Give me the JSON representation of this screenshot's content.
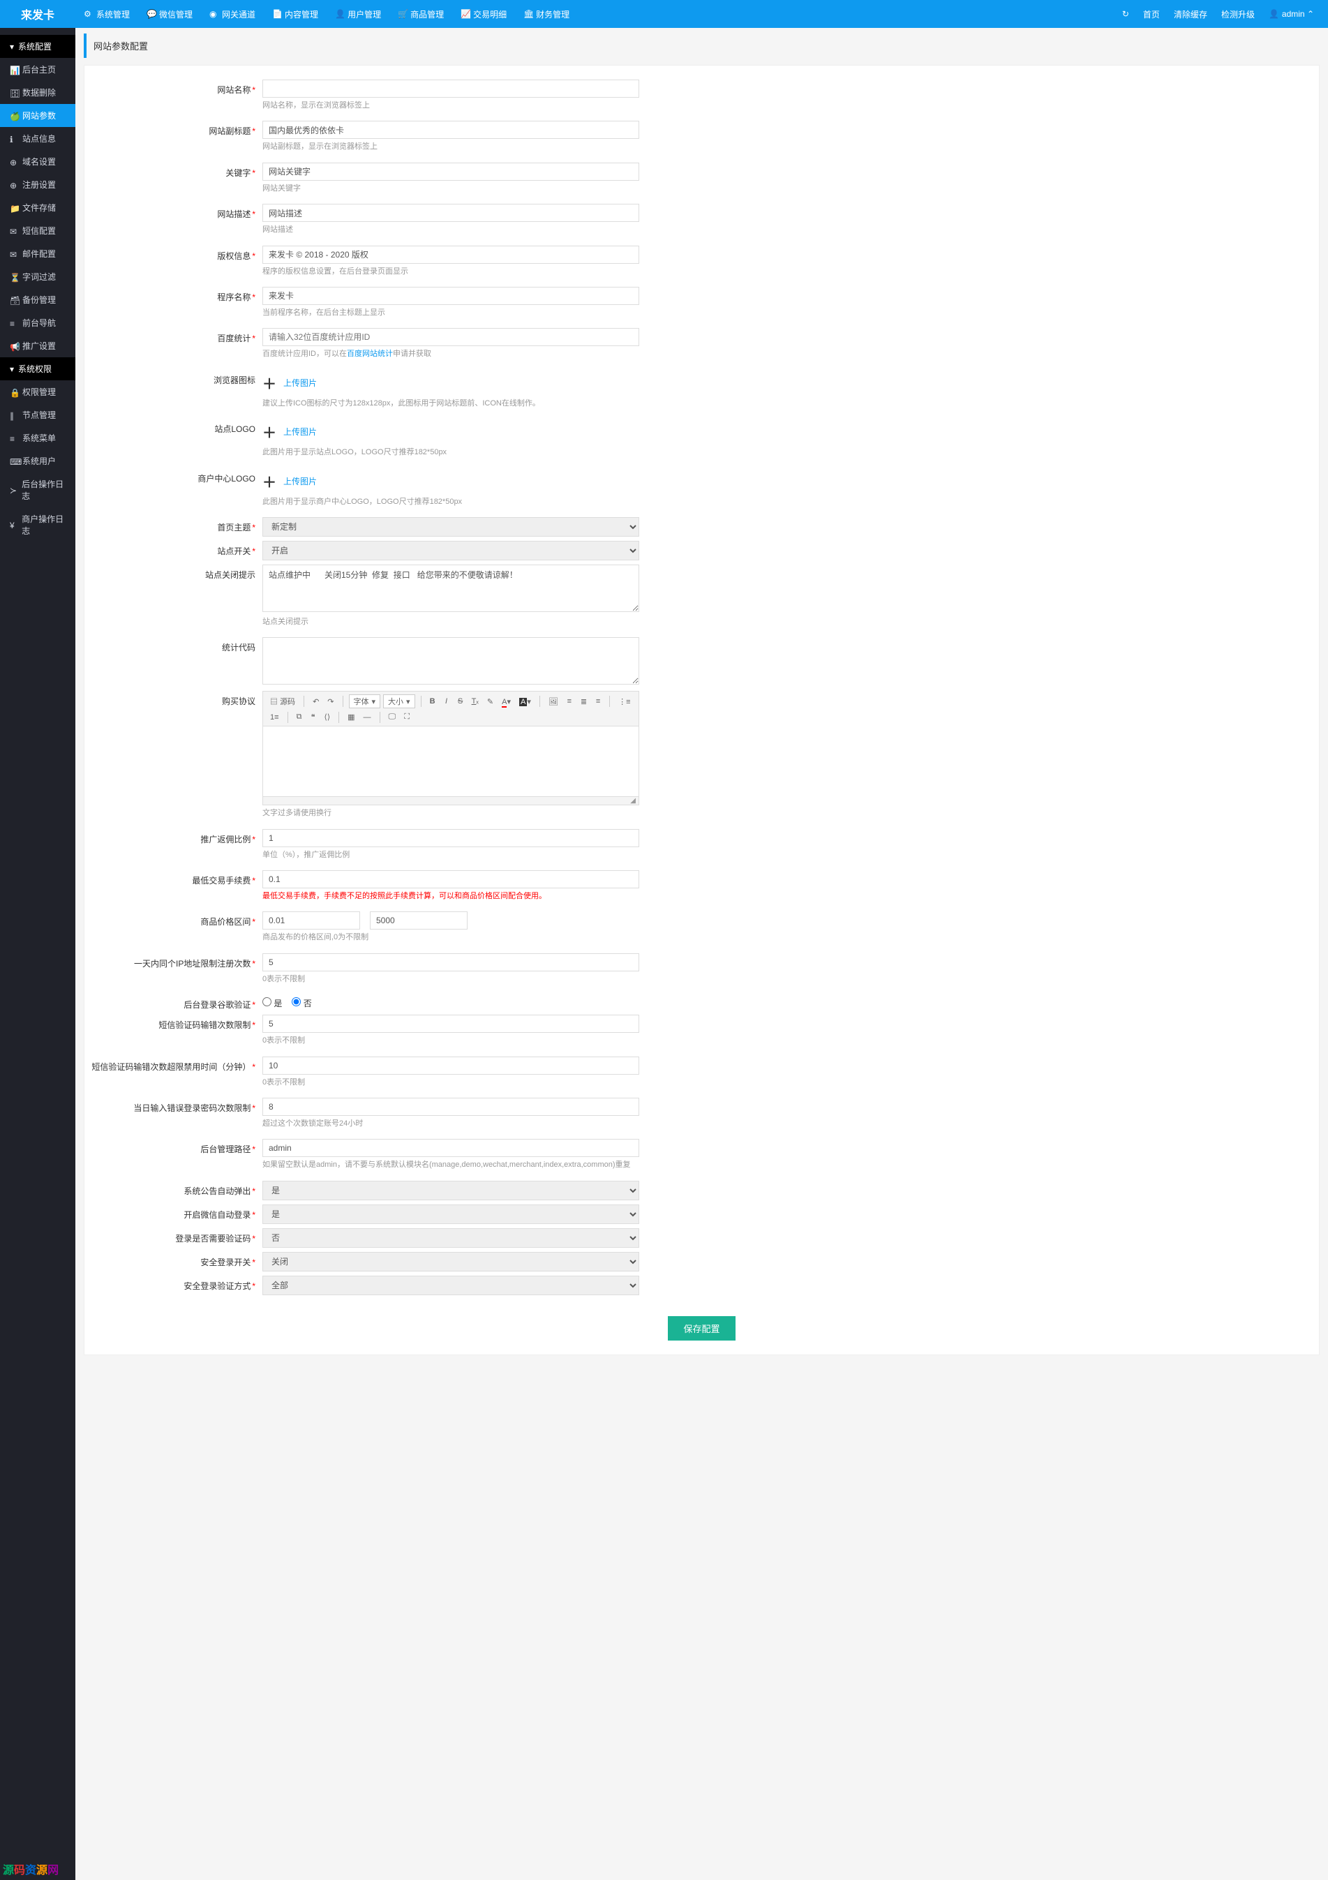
{
  "brand": "来发卡",
  "topnav": [
    {
      "icon": "⚙",
      "label": "系统管理"
    },
    {
      "icon": "💬",
      "label": "微信管理"
    },
    {
      "icon": "◉",
      "label": "网关通道"
    },
    {
      "icon": "📄",
      "label": "内容管理"
    },
    {
      "icon": "👤",
      "label": "用户管理"
    },
    {
      "icon": "🛒",
      "label": "商品管理"
    },
    {
      "icon": "📈",
      "label": "交易明细"
    },
    {
      "icon": "🏛",
      "label": "财务管理"
    }
  ],
  "topright": {
    "refresh_icon": "↻",
    "home": "首页",
    "clear": "清除缓存",
    "upgrade": "检测升级",
    "user_icon": "👤",
    "user": "admin ⌃"
  },
  "sidebar": {
    "group1": {
      "title": "系统配置",
      "items": [
        {
          "icon": "📊",
          "label": "后台主页"
        },
        {
          "icon": "🗄",
          "label": "数据删除"
        },
        {
          "icon": "🍏",
          "label": "网站参数",
          "active": true
        },
        {
          "icon": "ℹ",
          "label": "站点信息"
        },
        {
          "icon": "⊕",
          "label": "域名设置"
        },
        {
          "icon": "⊕",
          "label": "注册设置"
        },
        {
          "icon": "📁",
          "label": "文件存储"
        },
        {
          "icon": "✉",
          "label": "短信配置"
        },
        {
          "icon": "✉",
          "label": "邮件配置"
        },
        {
          "icon": "⏳",
          "label": "字词过滤"
        },
        {
          "icon": "🗃",
          "label": "备份管理"
        },
        {
          "icon": "≡",
          "label": "前台导航"
        },
        {
          "icon": "📢",
          "label": "推广设置"
        }
      ]
    },
    "group2": {
      "title": "系统权限",
      "items": [
        {
          "icon": "🔒",
          "label": "权限管理"
        },
        {
          "icon": "∥",
          "label": "节点管理"
        },
        {
          "icon": "≡",
          "label": "系统菜单"
        },
        {
          "icon": "⌨",
          "label": "系统用户"
        },
        {
          "icon": "≻",
          "label": "后台操作日志"
        },
        {
          "icon": "¥",
          "label": "商户操作日志"
        }
      ]
    }
  },
  "page": {
    "title": "网站参数配置"
  },
  "f": {
    "site_name": {
      "label": "网站名称",
      "help": "网站名称，显示在浏览器标签上"
    },
    "site_subtitle": {
      "label": "网站副标题",
      "value": "国内最优秀的依依卡",
      "help": "网站副标题，显示在浏览器标签上"
    },
    "keywords": {
      "label": "关键字",
      "value": "网站关键字",
      "help": "网站关键字"
    },
    "description": {
      "label": "网站描述",
      "value": "网站描述",
      "help": "网站描述"
    },
    "copyright": {
      "label": "版权信息",
      "value": "来发卡 © 2018 - 2020 版权",
      "help": "程序的版权信息设置，在后台登录页面显示"
    },
    "program_name": {
      "label": "程序名称",
      "value": "来发卡",
      "help": "当前程序名称，在后台主标题上显示"
    },
    "baidu": {
      "label": "百度统计",
      "placeholder": "请输入32位百度统计应用ID",
      "help1": "百度统计应用ID，可以在",
      "link": "百度网站统计",
      "help2": "申请并获取"
    },
    "favicon": {
      "label": "浏览器图标",
      "upload": "上传图片",
      "help": "建议上传ICO图标的尺寸为128x128px，此图标用于网站标题前、ICON在线制作。"
    },
    "site_logo": {
      "label": "站点LOGO",
      "upload": "上传图片",
      "help": "此图片用于显示站点LOGO，LOGO尺寸推荐182*50px"
    },
    "merchant_logo": {
      "label": "商户中心LOGO",
      "upload": "上传图片",
      "help": "此图片用于显示商户中心LOGO，LOGO尺寸推荐182*50px"
    },
    "theme": {
      "label": "首页主题",
      "value": "新定制"
    },
    "site_switch": {
      "label": "站点开关",
      "value": "开启"
    },
    "close_tip": {
      "label": "站点关闭提示",
      "value": "站点维护中      关闭15分钟  修复  接口   给您带来的不便敬请谅解！",
      "help": "站点关闭提示"
    },
    "stat_code": {
      "label": "统计代码"
    },
    "agreement": {
      "label": "购买协议",
      "help": "文字过多请使用换行"
    },
    "promo_rate": {
      "label": "推广返佣比例",
      "value": "1",
      "help": "单位（%），推广返佣比例"
    },
    "min_fee": {
      "label": "最低交易手续费",
      "value": "0.1",
      "help": "最低交易手续费，手续费不足的按照此手续费计算，可以和商品价格区间配合使用。"
    },
    "price_range": {
      "label": "商品价格区间",
      "low": "0.01",
      "high": "5000",
      "help": "商品发布的价格区间,0为不限制"
    },
    "ip_limit": {
      "label": "一天内同个IP地址限制注册次数",
      "value": "5",
      "help": "0表示不限制"
    },
    "login_gcaptcha": {
      "label": "后台登录谷歌验证",
      "yes": "是",
      "no": "否"
    },
    "sms_wrong_limit": {
      "label": "短信验证码输错次数限制",
      "value": "5",
      "help": "0表示不限制"
    },
    "sms_ban_time": {
      "label": "短信验证码输错次数超限禁用时间（分钟）",
      "value": "10",
      "help": "0表示不限制"
    },
    "pwd_wrong_limit": {
      "label": "当日输入错误登录密码次数限制",
      "value": "8",
      "help": "超过这个次数锁定账号24小时"
    },
    "admin_path": {
      "label": "后台管理路径",
      "value": "admin",
      "help": "如果留空默认是admin，请不要与系统默认模块名(manage,demo,wechat,merchant,index,extra,common)重复"
    },
    "notice_popup": {
      "label": "系统公告自动弹出",
      "value": "是"
    },
    "wechat_autologin": {
      "label": "开启微信自动登录",
      "value": "是"
    },
    "login_captcha": {
      "label": "登录是否需要验证码",
      "value": "否"
    },
    "safe_login": {
      "label": "安全登录开关",
      "value": "关闭"
    },
    "safe_login_type": {
      "label": "安全登录验证方式",
      "value": "全部"
    }
  },
  "editor": {
    "source": "源码",
    "font": "字体",
    "size": "大小"
  },
  "save_btn": "保存配置",
  "watermark": "源码资源网"
}
